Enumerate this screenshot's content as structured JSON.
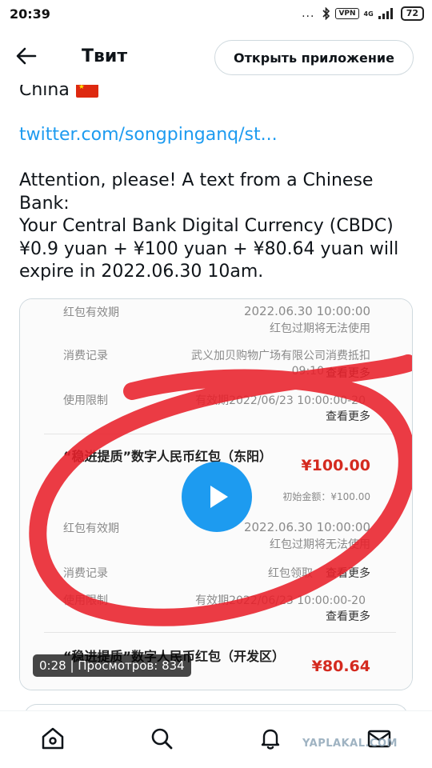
{
  "status_bar": {
    "time": "20:39",
    "dots": "...",
    "vpn": "VPN",
    "network": "4G",
    "battery": "72"
  },
  "header": {
    "title": "Твит",
    "open_app_label": "Открыть приложение"
  },
  "tweet": {
    "country": "China",
    "link": "twitter.com/songpinganq/st...",
    "text_lines": [
      "Attention, please! A text from a Chinese",
      "Bank:",
      "Your Central Bank Digital Currency (CBDC)",
      "¥0.9 yuan + ¥100 yuan + ¥80.64 yuan will",
      "expire in 2022.06.30 10am."
    ]
  },
  "media": {
    "screenshot_text": {
      "top_validity_label": "红包有效期",
      "top_validity_date": "2022.06.30 10:00:00",
      "top_expiry_note": "红包过期将无法使用",
      "top_record_label": "消费记录",
      "top_record_value": "武义加贝购物广场有限公司消费抵扣",
      "top_record_time": "09:10",
      "view_more": "查看更多",
      "top_limit_label": "使用限制",
      "top_limit_value": "有效期2022/06/23 10:00:00-20",
      "item_title": "“稳进提质”数字人民币红包（东阳）",
      "item_amount": "¥100.00",
      "initial_amount": "初始金额：¥100.00",
      "mid_validity_label": "红包有效期",
      "mid_validity_date": "2022.06.30 10:00:00",
      "mid_expiry_note": "红包过期将无法使用",
      "mid_record_label": "消费记录",
      "mid_record_value": "红包领取",
      "mid_limit_label": "使用限制",
      "mid_limit_value": "有效期2022/06/23 10:00:00-20",
      "next_item_title": "“稳进提质”数字人民币红包（开发区）",
      "next_item_amount": "¥80.64"
    },
    "video_stats": "0:28 | Просмотров: 834"
  },
  "watermark": "YAPLAKAL.COM",
  "colors": {
    "accent": "#1d9bf0",
    "text": "#0f1419",
    "circle_red": "#e8202a",
    "amount_red": "#d42a1f"
  },
  "icons": [
    "back-arrow-icon",
    "play-icon",
    "home-icon",
    "search-icon",
    "bell-icon",
    "mail-icon"
  ]
}
